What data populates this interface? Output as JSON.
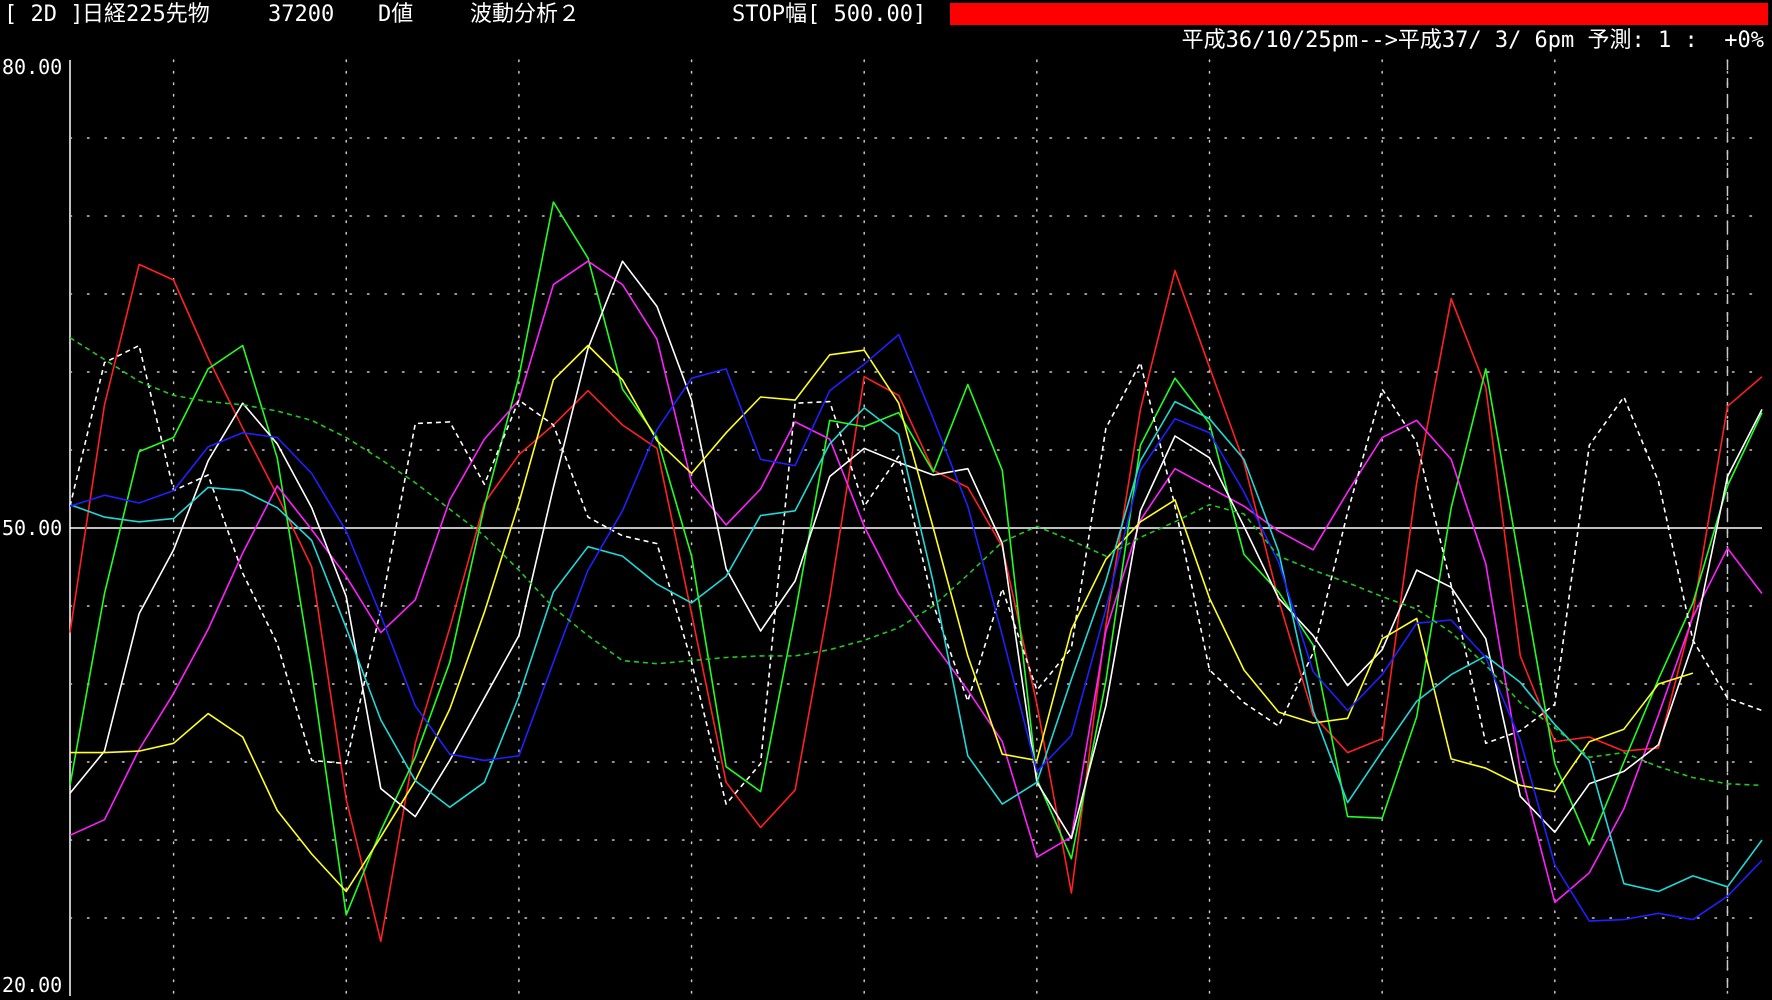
{
  "header": {
    "period_tag": "[ 2D ]",
    "instrument": "日経225先物",
    "price": "37200",
    "mode": "D値",
    "analysis": "波動分析２",
    "stop_width": "STOP幅[ 500.00]",
    "range_text": "平成36/10/25pm-->平成37/ 3/ 6pm 予測: 1 :  +0%"
  },
  "colors": {
    "background": "#000000",
    "stop_bar": "#ff0000",
    "grid": "#c8c8c8",
    "midline": "#ffffff"
  },
  "chart_data": {
    "type": "line",
    "ylim": [
      20,
      80
    ],
    "yticks": [
      "80.00",
      "50.00",
      "20.00"
    ],
    "midline": 50,
    "grid": true,
    "x_count": 50,
    "forecast_marker_index": 48,
    "series": [
      {
        "color": "#ff2020",
        "dash": false,
        "values": [
          43.3,
          57.9,
          66.9,
          65.9,
          60.9,
          56.4,
          52.1,
          47.5,
          32.6,
          23.5,
          36.2,
          43.6,
          51.6,
          54.7,
          56.6,
          58.8,
          56.6,
          55.1,
          44.5,
          33.7,
          30.8,
          33.2,
          45.5,
          59.7,
          58.5,
          53.7,
          52.6,
          48.8,
          38.7,
          26.6,
          43.8,
          57.6,
          66.5,
          60.3,
          54.2,
          45.4,
          38.0,
          35.6,
          36.5,
          52.9,
          64.7,
          59.0,
          41.8,
          36.3,
          36.6,
          35.7,
          35.9,
          44.5,
          57.8,
          59.7
        ]
      },
      {
        "color": "#20ff20",
        "dash": false,
        "values": [
          33.5,
          45.8,
          54.9,
          55.8,
          60.2,
          61.7,
          54.5,
          40.8,
          25.2,
          30.6,
          35.3,
          41.4,
          51.4,
          59.7,
          70.9,
          67.3,
          58.9,
          55.8,
          48.2,
          34.7,
          33.1,
          44.5,
          56.9,
          56.5,
          57.4,
          53.6,
          59.2,
          53.7,
          33.9,
          28.8,
          40.2,
          55.3,
          59.6,
          56.7,
          48.3,
          45.9,
          42.5,
          31.5,
          31.4,
          37.9,
          51.3,
          60.2,
          47.5,
          34.9,
          29.7,
          35.0,
          40.3,
          45.2,
          52.7,
          57.4
        ]
      },
      {
        "color": "#ff20ff",
        "dash": false,
        "values": [
          30.3,
          31.3,
          35.8,
          39.4,
          43.5,
          48.4,
          52.7,
          49.9,
          46.9,
          43.3,
          45.4,
          51.8,
          55.7,
          58.2,
          65.6,
          67.1,
          65.6,
          62.1,
          52.9,
          50.2,
          52.5,
          56.8,
          55.7,
          50.1,
          45.8,
          42.6,
          39.6,
          36.3,
          28.9,
          30.2,
          43.4,
          50.5,
          53.8,
          52.6,
          51.4,
          49.8,
          48.6,
          52.3,
          55.8,
          56.9,
          54.4,
          47.7,
          34.5,
          26.0,
          27.9,
          32.0,
          38.0,
          44.3,
          48.7,
          45.8
        ]
      },
      {
        "color": "#ffffff",
        "dash": false,
        "values": [
          33.0,
          35.7,
          44.5,
          48.6,
          54.3,
          58.0,
          55.4,
          51.3,
          45.6,
          33.3,
          31.5,
          35.1,
          39.1,
          43.1,
          52.6,
          61.5,
          67.1,
          64.2,
          58.2,
          47.4,
          43.4,
          46.6,
          53.3,
          55.1,
          54.2,
          53.4,
          53.8,
          49.0,
          33.7,
          30.1,
          38.6,
          51.1,
          55.9,
          54.5,
          50.1,
          45.5,
          43.1,
          39.9,
          42.2,
          47.3,
          46.2,
          42.9,
          32.8,
          30.5,
          33.6,
          34.4,
          36.1,
          42.6,
          53.3,
          57.6
        ]
      },
      {
        "color": "#ffffff",
        "dash": true,
        "values": [
          51.4,
          60.6,
          61.7,
          52.4,
          53.4,
          47.1,
          42.6,
          35.1,
          34.9,
          44.8,
          56.7,
          56.8,
          52.8,
          58.2,
          56.6,
          50.7,
          49.5,
          49.0,
          41.4,
          32.3,
          34.9,
          58.0,
          58.1,
          51.4,
          54.6,
          45.1,
          38.9,
          46.1,
          39.6,
          42.3,
          56.4,
          60.6,
          51.4,
          40.9,
          38.8,
          37.3,
          42.0,
          51.0,
          58.9,
          55.5,
          46.3,
          36.2,
          37.0,
          38.7,
          55.3,
          58.4,
          53.0,
          42.8,
          39.1,
          38.3
        ]
      },
      {
        "color": "#ffff20",
        "dash": false,
        "values": [
          35.6,
          35.6,
          35.7,
          36.2,
          38.1,
          36.6,
          31.9,
          29.1,
          26.7,
          30.2,
          33.8,
          38.4,
          44.6,
          51.6,
          59.5,
          61.7,
          59.5,
          55.6,
          53.5,
          56.1,
          58.4,
          58.2,
          61.1,
          61.4,
          58.0,
          50.0,
          41.8,
          35.5,
          35.1,
          43.5,
          48.0,
          50.4,
          51.8,
          45.5,
          40.9,
          38.2,
          37.5,
          37.8,
          42.9,
          44.2,
          35.2,
          34.6,
          33.5,
          33.1,
          36.3,
          37.1,
          40.0,
          40.7
        ]
      },
      {
        "color": "#20d8d8",
        "dash": false,
        "values": [
          51.5,
          50.7,
          50.4,
          50.6,
          52.6,
          52.4,
          51.3,
          49.2,
          43.6,
          37.7,
          33.8,
          32.1,
          33.7,
          39.2,
          45.9,
          48.8,
          48.2,
          46.4,
          45.2,
          46.9,
          50.8,
          51.1,
          55.4,
          57.7,
          56.0,
          46.5,
          35.4,
          32.3,
          33.7,
          40.3,
          46.6,
          54.3,
          58.1,
          57.0,
          54.4,
          48.5,
          38.3,
          32.4,
          35.7,
          38.9,
          40.6,
          41.8,
          40.1,
          37.4,
          35.1,
          27.2,
          26.7,
          27.7,
          27.0,
          30.0
        ]
      },
      {
        "color": "#2020ff",
        "dash": false,
        "values": [
          51.4,
          52.1,
          51.6,
          52.4,
          55.2,
          56.1,
          55.8,
          53.5,
          49.8,
          44.4,
          38.6,
          35.5,
          35.1,
          35.4,
          41.4,
          47.3,
          51.1,
          56.3,
          59.6,
          60.2,
          54.4,
          54.0,
          58.8,
          60.5,
          62.4,
          57.0,
          51.4,
          43.1,
          34.4,
          36.7,
          44.8,
          53.7,
          57.0,
          56.1,
          52.3,
          47.8,
          40.8,
          38.3,
          40.6,
          43.9,
          44.1,
          41.7,
          36.4,
          28.4,
          24.8,
          24.9,
          25.3,
          24.9,
          26.4,
          28.7
        ]
      },
      {
        "color": "#20c820",
        "dash": true,
        "values": [
          62.2,
          60.8,
          59.4,
          58.5,
          58.1,
          57.9,
          57.5,
          56.9,
          55.8,
          54.4,
          52.9,
          51.2,
          49.5,
          47.3,
          44.9,
          43.1,
          41.5,
          41.3,
          41.5,
          41.7,
          41.8,
          41.8,
          42.2,
          42.8,
          43.6,
          45.0,
          47.0,
          49.1,
          50.1,
          49.2,
          48.2,
          49.4,
          50.4,
          51.5,
          50.9,
          48.2,
          47.3,
          46.5,
          45.6,
          44.8,
          43.3,
          41.2,
          38.8,
          37.2,
          35.3,
          35.6,
          34.7,
          34.0,
          33.6,
          33.5
        ]
      }
    ]
  }
}
